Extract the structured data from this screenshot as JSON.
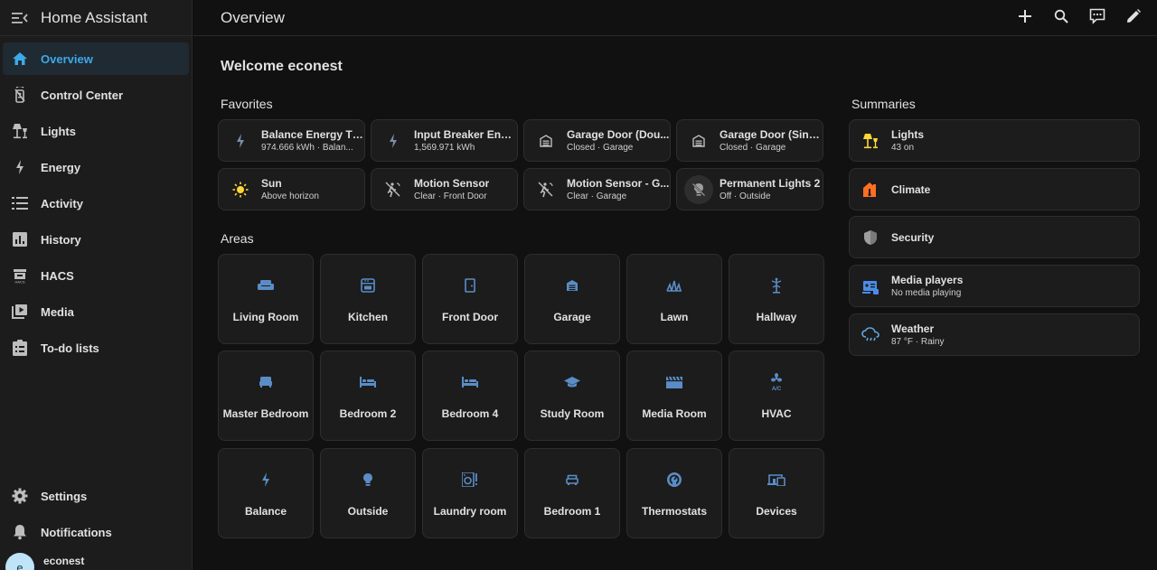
{
  "app": {
    "title": "Home Assistant"
  },
  "sidebar": {
    "items": [
      {
        "label": "Overview",
        "icon": "home-icon"
      },
      {
        "label": "Control Center",
        "icon": "remote-icon"
      },
      {
        "label": "Lights",
        "icon": "floor-lamp-icon"
      },
      {
        "label": "Energy",
        "icon": "lightning-icon"
      },
      {
        "label": "Activity",
        "icon": "format-list-icon"
      },
      {
        "label": "History",
        "icon": "chart-box-icon"
      },
      {
        "label": "HACS",
        "icon": "hacs-icon"
      },
      {
        "label": "Media",
        "icon": "play-box-icon"
      },
      {
        "label": "To-do lists",
        "icon": "clipboard-list-icon"
      }
    ],
    "bottom": [
      {
        "label": "Settings",
        "icon": "cog-icon"
      },
      {
        "label": "Notifications",
        "icon": "bell-icon"
      }
    ],
    "user": {
      "name": "econest",
      "initial": "e"
    }
  },
  "header": {
    "title": "Overview"
  },
  "main": {
    "welcome": "Welcome econest",
    "favorites_title": "Favorites",
    "areas_title": "Areas",
    "summaries_title": "Summaries",
    "favorites": [
      {
        "name": "Balance Energy Th...",
        "state": "974.666 kWh · Balan...",
        "icon": "lightning-icon"
      },
      {
        "name": "Input Breaker Ener...",
        "state": "1,569.971 kWh",
        "icon": "lightning-icon"
      },
      {
        "name": "Garage Door (Dou...",
        "state": "Closed · Garage",
        "icon": "garage-icon"
      },
      {
        "name": "Garage Door (Sing...",
        "state": "Closed · Garage",
        "icon": "garage-icon"
      },
      {
        "name": "Sun",
        "state": "Above horizon",
        "icon": "sun-icon"
      },
      {
        "name": "Motion Sensor",
        "state": "Clear · Front Door",
        "icon": "motion-sensor-icon"
      },
      {
        "name": "Motion Sensor - G...",
        "state": "Clear · Garage",
        "icon": "motion-sensor-icon"
      },
      {
        "name": "Permanent Lights 2",
        "state": "Off · Outside",
        "icon": "lightbulb-off-icon"
      }
    ],
    "areas": [
      {
        "name": "Living Room",
        "icon": "sofa-icon"
      },
      {
        "name": "Kitchen",
        "icon": "stove-icon"
      },
      {
        "name": "Front Door",
        "icon": "door-icon"
      },
      {
        "name": "Garage",
        "icon": "garage-icon"
      },
      {
        "name": "Lawn",
        "icon": "grass-icon"
      },
      {
        "name": "Hallway",
        "icon": "coat-rack-icon"
      },
      {
        "name": "Master Bedroom",
        "icon": "bed-icon"
      },
      {
        "name": "Bedroom 2",
        "icon": "bed-icon"
      },
      {
        "name": "Bedroom 4",
        "icon": "bed-icon"
      },
      {
        "name": "Study Room",
        "icon": "school-icon"
      },
      {
        "name": "Media Room",
        "icon": "movie-icon"
      },
      {
        "name": "HVAC",
        "icon": "hvac-icon"
      },
      {
        "name": "Balance",
        "icon": "lightning-icon"
      },
      {
        "name": "Outside",
        "icon": "lightbulb-icon"
      },
      {
        "name": "Laundry room",
        "icon": "washing-machine-icon"
      },
      {
        "name": "Bedroom 1",
        "icon": "bed-outline-icon"
      },
      {
        "name": "Thermostats",
        "icon": "thermostat-icon"
      },
      {
        "name": "Devices",
        "icon": "devices-icon"
      }
    ],
    "summaries": [
      {
        "name": "Lights",
        "state": "43 on",
        "icon": "floor-lamp-icon",
        "color": "#fdd835"
      },
      {
        "name": "Climate",
        "state": "",
        "icon": "home-thermometer-icon",
        "color": "#ff6f22"
      },
      {
        "name": "Security",
        "state": "",
        "icon": "shield-icon",
        "color": "#9e9e9e"
      },
      {
        "name": "Media players",
        "state": "No media playing",
        "icon": "multimedia-icon",
        "color": "#4a8de9"
      },
      {
        "name": "Weather",
        "state": "87 °F · Rainy",
        "icon": "weather-rainy-icon",
        "color": "#5ea7e6"
      }
    ]
  },
  "colors": {
    "accent": "#3da9e8",
    "icon_blue": "#5a8dc6",
    "energy": "#7a8da8",
    "sun": "#fdd835",
    "background": "#111111",
    "card": "#1c1c1c"
  }
}
